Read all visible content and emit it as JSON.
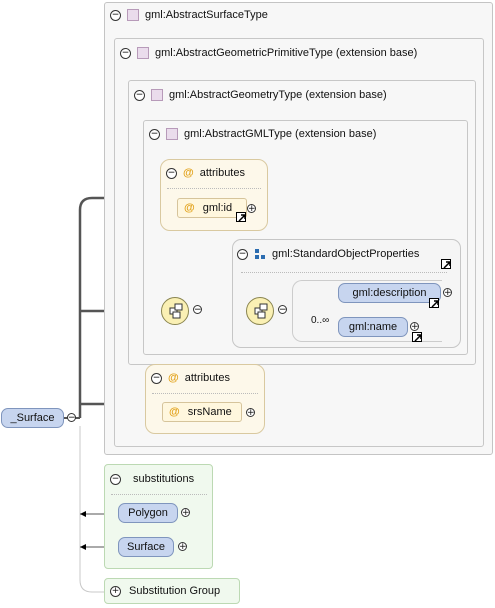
{
  "colors": {
    "attr_at": "#e2a21a",
    "element_fill": "#c7d5ef",
    "subst_fill": "#f0f9ee",
    "compositor_fill": "#faf0b4"
  },
  "types": {
    "surface_type": "gml:AbstractSurfaceType",
    "geometric_primitive": "gml:AbstractGeometricPrimitiveType (extension base)",
    "geometry_type": "gml:AbstractGeometryType (extension base)",
    "gml_type": "gml:AbstractGMLType (extension base)"
  },
  "attributes_a": {
    "title": "attributes",
    "items": [
      {
        "name": "gml:id"
      }
    ]
  },
  "standard_props": {
    "title": "gml:StandardObjectProperties",
    "cardinality": "0..∞",
    "elements": [
      "gml:description",
      "gml:name"
    ]
  },
  "attributes_b": {
    "title": "attributes",
    "items": [
      {
        "name": "srsName"
      }
    ]
  },
  "root": {
    "name": "_Surface"
  },
  "substitutions": {
    "title": "substitutions",
    "items": [
      "Polygon",
      "Surface"
    ]
  },
  "substitution_group": {
    "title": "Substitution Group"
  }
}
